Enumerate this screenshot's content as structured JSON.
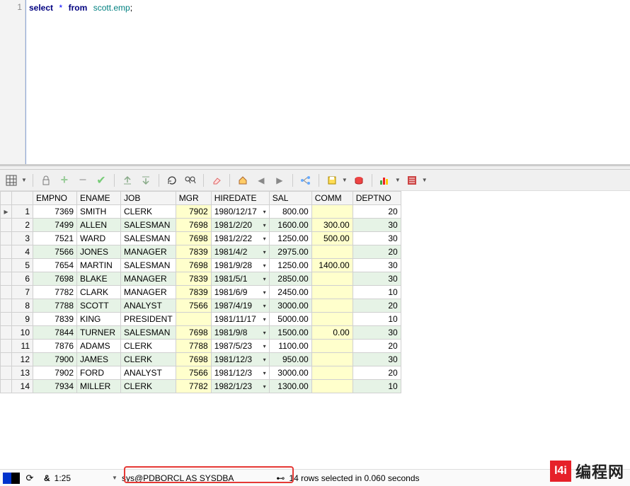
{
  "editor": {
    "line_no": "1",
    "sql_prefix": "select",
    "star": "*",
    "from": "from",
    "table": "scott.emp",
    "semi": ";"
  },
  "toolbar": {
    "grid": "grid-icon",
    "lock": "lock-icon",
    "plus": "plus-icon",
    "minus": "minus-icon",
    "check": "check-icon",
    "post": "post-icon",
    "refresh": "refresh-icon",
    "redo": "redo-icon",
    "find": "find-icon",
    "erase": "erase-icon",
    "home": "home-icon",
    "left": "left-icon",
    "right": "right-icon",
    "tree": "tree-icon",
    "save": "save-icon",
    "disk": "disk-icon",
    "chart": "chart-icon",
    "list": "list-icon"
  },
  "columns": [
    "EMPNO",
    "ENAME",
    "JOB",
    "MGR",
    "HIREDATE",
    "SAL",
    "COMM",
    "DEPTNO"
  ],
  "rows": [
    {
      "n": "1",
      "empno": "7369",
      "ename": "SMITH",
      "job": "CLERK",
      "mgr": "7902",
      "hiredate": "1980/12/17",
      "sal": "800.00",
      "comm": "",
      "deptno": "20"
    },
    {
      "n": "2",
      "empno": "7499",
      "ename": "ALLEN",
      "job": "SALESMAN",
      "mgr": "7698",
      "hiredate": "1981/2/20",
      "sal": "1600.00",
      "comm": "300.00",
      "deptno": "30"
    },
    {
      "n": "3",
      "empno": "7521",
      "ename": "WARD",
      "job": "SALESMAN",
      "mgr": "7698",
      "hiredate": "1981/2/22",
      "sal": "1250.00",
      "comm": "500.00",
      "deptno": "30"
    },
    {
      "n": "4",
      "empno": "7566",
      "ename": "JONES",
      "job": "MANAGER",
      "mgr": "7839",
      "hiredate": "1981/4/2",
      "sal": "2975.00",
      "comm": "",
      "deptno": "20"
    },
    {
      "n": "5",
      "empno": "7654",
      "ename": "MARTIN",
      "job": "SALESMAN",
      "mgr": "7698",
      "hiredate": "1981/9/28",
      "sal": "1250.00",
      "comm": "1400.00",
      "deptno": "30"
    },
    {
      "n": "6",
      "empno": "7698",
      "ename": "BLAKE",
      "job": "MANAGER",
      "mgr": "7839",
      "hiredate": "1981/5/1",
      "sal": "2850.00",
      "comm": "",
      "deptno": "30"
    },
    {
      "n": "7",
      "empno": "7782",
      "ename": "CLARK",
      "job": "MANAGER",
      "mgr": "7839",
      "hiredate": "1981/6/9",
      "sal": "2450.00",
      "comm": "",
      "deptno": "10"
    },
    {
      "n": "8",
      "empno": "7788",
      "ename": "SCOTT",
      "job": "ANALYST",
      "mgr": "7566",
      "hiredate": "1987/4/19",
      "sal": "3000.00",
      "comm": "",
      "deptno": "20"
    },
    {
      "n": "9",
      "empno": "7839",
      "ename": "KING",
      "job": "PRESIDENT",
      "mgr": "",
      "hiredate": "1981/11/17",
      "sal": "5000.00",
      "comm": "",
      "deptno": "10"
    },
    {
      "n": "10",
      "empno": "7844",
      "ename": "TURNER",
      "job": "SALESMAN",
      "mgr": "7698",
      "hiredate": "1981/9/8",
      "sal": "1500.00",
      "comm": "0.00",
      "deptno": "30"
    },
    {
      "n": "11",
      "empno": "7876",
      "ename": "ADAMS",
      "job": "CLERK",
      "mgr": "7788",
      "hiredate": "1987/5/23",
      "sal": "1100.00",
      "comm": "",
      "deptno": "20"
    },
    {
      "n": "12",
      "empno": "7900",
      "ename": "JAMES",
      "job": "CLERK",
      "mgr": "7698",
      "hiredate": "1981/12/3",
      "sal": "950.00",
      "comm": "",
      "deptno": "30"
    },
    {
      "n": "13",
      "empno": "7902",
      "ename": "FORD",
      "job": "ANALYST",
      "mgr": "7566",
      "hiredate": "1981/12/3",
      "sal": "3000.00",
      "comm": "",
      "deptno": "20"
    },
    {
      "n": "14",
      "empno": "7934",
      "ename": "MILLER",
      "job": "CLERK",
      "mgr": "7782",
      "hiredate": "1982/1/23",
      "sal": "1300.00",
      "comm": "",
      "deptno": "10"
    }
  ],
  "status": {
    "ratio": "1:25",
    "conn": "sys@PDBORCL AS SYSDBA",
    "msg": "14 rows selected in 0.060 seconds"
  },
  "watermark": {
    "logo": "l4i",
    "text": "编程网"
  },
  "colors": {
    "even": "#e6f3e6",
    "yellow": "#ffffcc",
    "kw": "#000080"
  }
}
